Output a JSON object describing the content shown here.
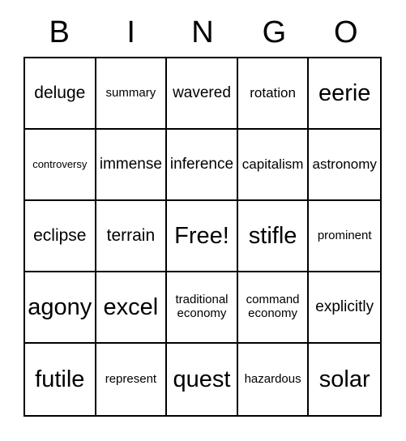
{
  "card": {
    "title": "BINGO",
    "header_letters": [
      "B",
      "I",
      "N",
      "G",
      "O"
    ],
    "free_space_label": "Free!",
    "colors": {
      "border": "#000000",
      "text": "#000000",
      "background": "#ffffff"
    },
    "grid": {
      "rows": 5,
      "columns": 5,
      "cells": [
        [
          {
            "text": "deluge",
            "size": "sz-l"
          },
          {
            "text": "summary",
            "size": "sz-s"
          },
          {
            "text": "wavered",
            "size": "sz-ml"
          },
          {
            "text": "rotation",
            "size": "sz-m"
          },
          {
            "text": "eerie",
            "size": "sz-xxl"
          }
        ],
        [
          {
            "text": "controversy",
            "size": "sz-xs"
          },
          {
            "text": "immense",
            "size": "sz-ml"
          },
          {
            "text": "inference",
            "size": "sz-ml"
          },
          {
            "text": "capitalism",
            "size": "sz-m"
          },
          {
            "text": "astronomy",
            "size": "sz-m"
          }
        ],
        [
          {
            "text": "eclipse",
            "size": "sz-l"
          },
          {
            "text": "terrain",
            "size": "sz-l"
          },
          {
            "text": "Free!",
            "size": "sz-xxl"
          },
          {
            "text": "stifle",
            "size": "sz-xxl"
          },
          {
            "text": "prominent",
            "size": "sz-s"
          }
        ],
        [
          {
            "text": "agony",
            "size": "sz-xxl"
          },
          {
            "text": "excel",
            "size": "sz-xxl"
          },
          {
            "text": "traditional economy",
            "size": "sz-s"
          },
          {
            "text": "command economy",
            "size": "sz-s"
          },
          {
            "text": "explicitly",
            "size": "sz-ml"
          }
        ],
        [
          {
            "text": "futile",
            "size": "sz-xxl"
          },
          {
            "text": "represent",
            "size": "sz-s"
          },
          {
            "text": "quest",
            "size": "sz-xxl"
          },
          {
            "text": "hazardous",
            "size": "sz-s"
          },
          {
            "text": "solar",
            "size": "sz-xxl"
          }
        ]
      ]
    }
  }
}
